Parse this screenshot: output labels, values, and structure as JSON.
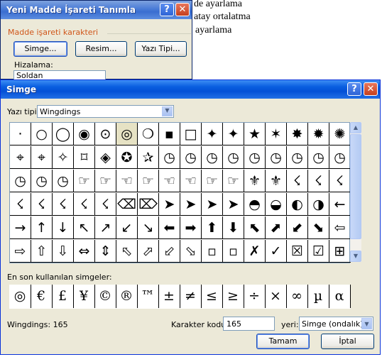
{
  "document": {
    "lines": [
      "de ayarlama",
      "atay ortalatma",
      "ayarlama"
    ]
  },
  "bg_dialog": {
    "title": "Yeni Madde İşareti Tanımla",
    "group_label": "Madde işareti karakteri",
    "buttons": [
      "Simge...",
      "Resim...",
      "Yazı Tipi..."
    ],
    "align_label": "Hizalama:",
    "align_value": "Soldan"
  },
  "dialog": {
    "title": "Simge",
    "font_label": "Yazı tipi:",
    "font_value": "Wingdings",
    "symbols": [
      [
        "·",
        "○",
        "◯",
        "◉",
        "⊙",
        "◎",
        "❍",
        "▪",
        "□",
        "✦",
        "✦",
        "★",
        "✶",
        "✸",
        "✹",
        "✺"
      ],
      [
        "⌖",
        "⌖",
        "✧",
        "⌑",
        "◈",
        "✪",
        "✰",
        "◷",
        "◷",
        "◷",
        "◷",
        "◷",
        "◷",
        "◷",
        "◷",
        "◷"
      ],
      [
        "◷",
        "◷",
        "◷",
        "☞",
        "☞",
        "☜",
        "☞",
        "☜",
        "☜",
        "☞",
        "☞",
        "⚜",
        "⚜",
        "☇",
        "☇",
        "☇"
      ],
      [
        "☇",
        "☇",
        "☇",
        "☇",
        "☇",
        "⌫",
        "⌦",
        "➤",
        "➤",
        "➤",
        "➤",
        "◓",
        "◒",
        "◐",
        "◑",
        "←"
      ],
      [
        "→",
        "↑",
        "↓",
        "↖",
        "↗",
        "↙",
        "↘",
        "⬅",
        "➡",
        "⬆",
        "⬇",
        "⬉",
        "⬈",
        "⬋",
        "⬊",
        "⇦"
      ],
      [
        "⇨",
        "⇧",
        "⇩",
        "⇔",
        "⇕",
        "⬁",
        "⬀",
        "⬃",
        "⬂",
        "▫",
        "▫",
        "✗",
        "✓",
        "☒",
        "☑",
        "⊞"
      ]
    ],
    "recent_label": "En son kullanılan simgeler:",
    "recent": [
      "◎",
      "€",
      "£",
      "¥",
      "©",
      "®",
      "™",
      "±",
      "≠",
      "≤",
      "≥",
      "÷",
      "×",
      "∞",
      "µ",
      "α"
    ],
    "status": "Wingdings: 165",
    "code_label": "Karakter kodu:",
    "code_value": "165",
    "from_label": "yeri:",
    "from_value": "Simge (ondalık)",
    "ok": "Tamam",
    "cancel": "İptal"
  }
}
